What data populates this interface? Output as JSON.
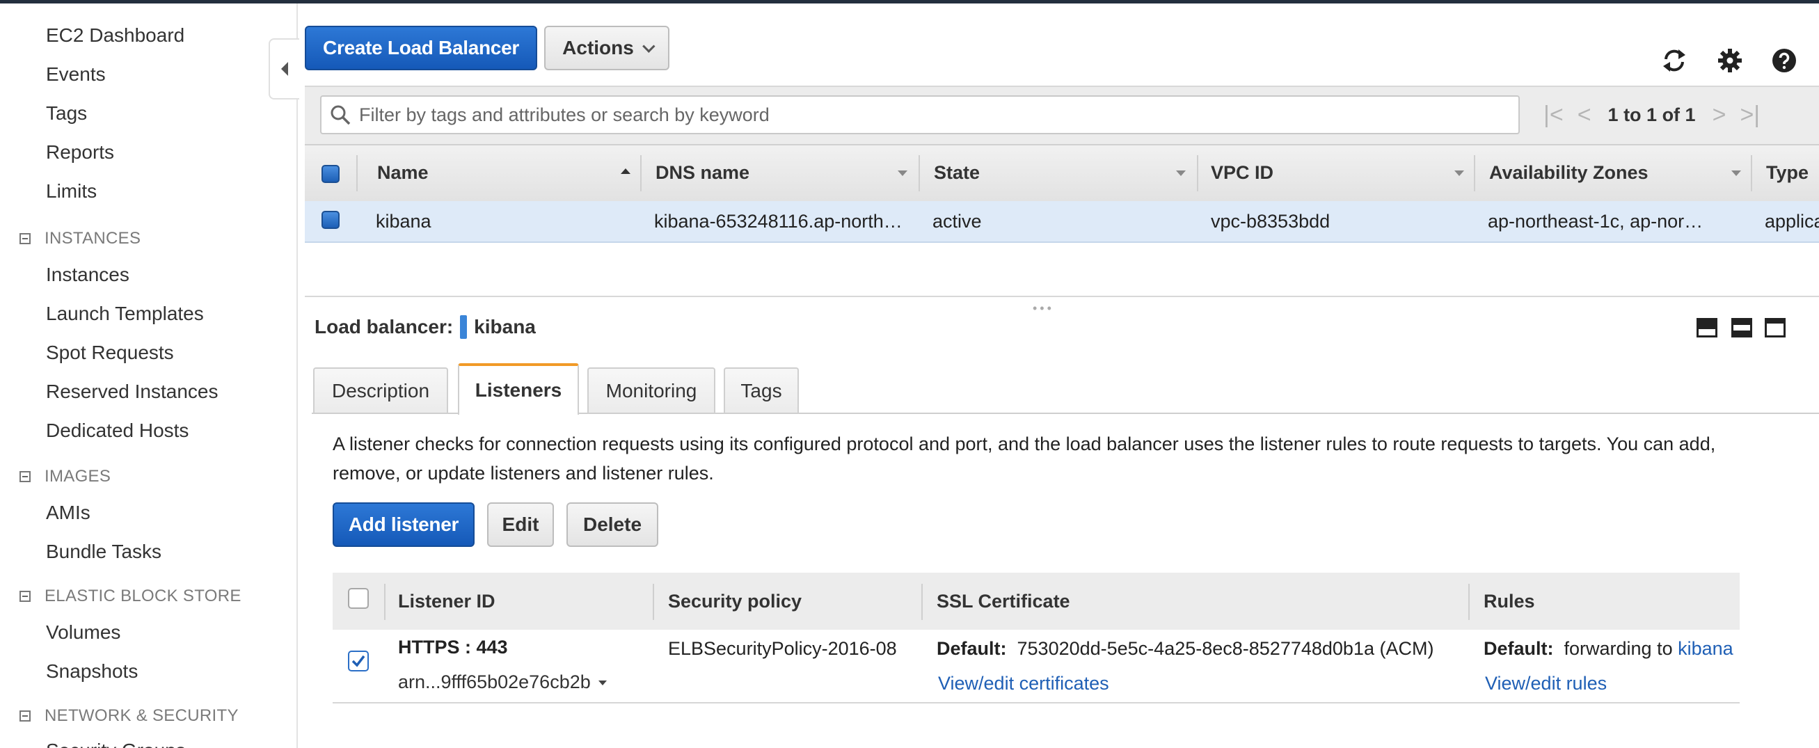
{
  "sidebar": {
    "items_top": [
      "EC2 Dashboard",
      "Events",
      "Tags",
      "Reports",
      "Limits"
    ],
    "sections": [
      {
        "title": "INSTANCES",
        "items": [
          "Instances",
          "Launch Templates",
          "Spot Requests",
          "Reserved Instances",
          "Dedicated Hosts"
        ]
      },
      {
        "title": "IMAGES",
        "items": [
          "AMIs",
          "Bundle Tasks"
        ]
      },
      {
        "title": "ELASTIC BLOCK STORE",
        "items": [
          "Volumes",
          "Snapshots"
        ]
      },
      {
        "title": "NETWORK & SECURITY",
        "items": [
          "Security Groups"
        ]
      }
    ]
  },
  "toolbar": {
    "create_label": "Create Load Balancer",
    "actions_label": "Actions",
    "icons": [
      "refresh-icon",
      "gear-icon",
      "help-icon"
    ]
  },
  "search": {
    "placeholder": "Filter by tags and attributes or search by keyword",
    "pager_text": "1 to 1 of 1"
  },
  "lb_table": {
    "columns": [
      "Name",
      "DNS name",
      "State",
      "VPC ID",
      "Availability Zones",
      "Type"
    ],
    "rows": [
      [
        "kibana",
        "kibana-653248116.ap-northe…",
        "active",
        "vpc-b8353bdd",
        "ap-northeast-1c, ap-nor…",
        "applicatio"
      ]
    ]
  },
  "details": {
    "label": "Load balancer:",
    "name": "kibana",
    "tabs": [
      "Description",
      "Listeners",
      "Monitoring",
      "Tags"
    ],
    "active_tab": "Listeners",
    "description": "A listener checks for connection requests using its configured protocol and port, and the load balancer uses the listener rules to route requests to targets. You can add, remove, or update listeners and listener rules.",
    "buttons": {
      "add": "Add listener",
      "edit": "Edit",
      "delete": "Delete"
    }
  },
  "listeners": {
    "columns": [
      "Listener ID",
      "Security policy",
      "SSL Certificate",
      "Rules"
    ],
    "rows": [
      {
        "id": "HTTPS : 443",
        "arn": "arn...9fff65b02e76cb2b",
        "policy": "ELBSecurityPolicy-2016-08",
        "cert_label": "Default:",
        "cert_value": "753020dd-5e5c-4a25-8ec8-8527748d0b1a (ACM)",
        "cert_link": "View/edit certificates",
        "rules_label": "Default:",
        "rules_text": "forwarding to",
        "rules_target": "kibana",
        "rules_link": "View/edit rules"
      }
    ]
  },
  "colors": {
    "primary": "#1f66c6",
    "tab_accent": "#f19a27",
    "selected_row": "#deeaf8",
    "link": "#1f5fb5"
  }
}
